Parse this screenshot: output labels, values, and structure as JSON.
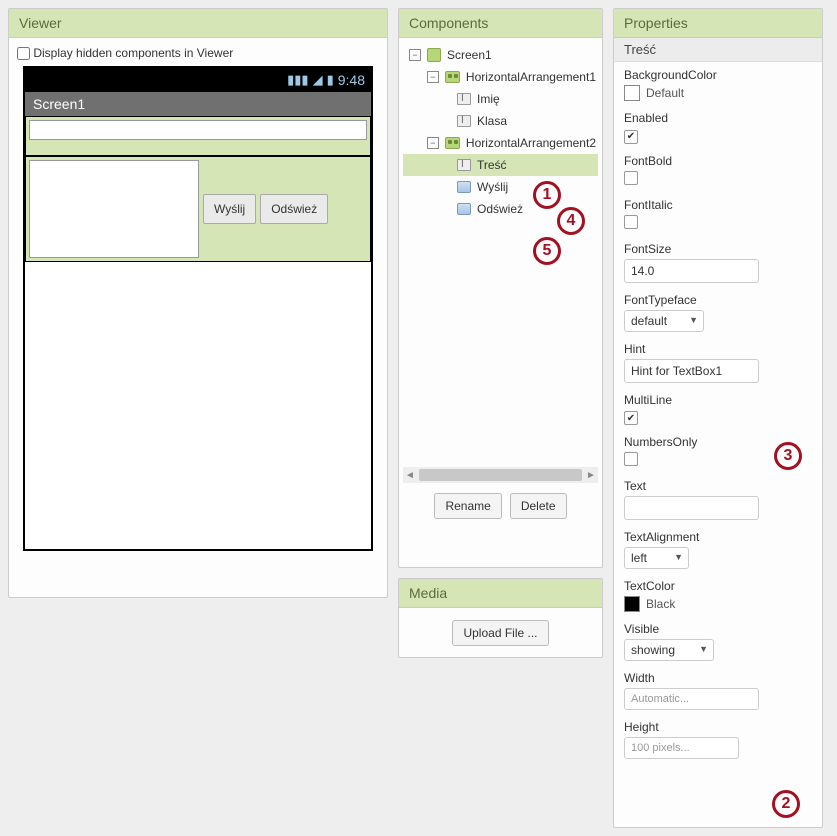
{
  "viewer": {
    "header": "Viewer",
    "hiddenLabel": "Display hidden components in Viewer",
    "hiddenChecked": false,
    "statusTime": "9:48",
    "screenTitle": "Screen1",
    "buttons": {
      "send": "Wyślij",
      "refresh": "Odśwież"
    }
  },
  "components": {
    "header": "Components",
    "tree": {
      "screen1": "Screen1",
      "harr1": "HorizontalArrangement1",
      "imie": "Imię",
      "klasa": "Klasa",
      "harr2": "HorizontalArrangement2",
      "tresc": "Treść",
      "wyslij": "Wyślij",
      "odswiez": "Odśwież"
    },
    "rename": "Rename",
    "delete": "Delete"
  },
  "media": {
    "header": "Media",
    "upload": "Upload File ..."
  },
  "properties": {
    "header": "Properties",
    "selected": "Treść",
    "BackgroundColor": {
      "label": "BackgroundColor",
      "value": "Default"
    },
    "Enabled": {
      "label": "Enabled",
      "checked": true
    },
    "FontBold": {
      "label": "FontBold",
      "checked": false
    },
    "FontItalic": {
      "label": "FontItalic",
      "checked": false
    },
    "FontSize": {
      "label": "FontSize",
      "value": "14.0"
    },
    "FontTypeface": {
      "label": "FontTypeface",
      "value": "default"
    },
    "Hint": {
      "label": "Hint",
      "value": "Hint for TextBox1"
    },
    "MultiLine": {
      "label": "MultiLine",
      "checked": true
    },
    "NumbersOnly": {
      "label": "NumbersOnly",
      "checked": false
    },
    "Text": {
      "label": "Text",
      "value": ""
    },
    "TextAlignment": {
      "label": "TextAlignment",
      "value": "left"
    },
    "TextColor": {
      "label": "TextColor",
      "value": "Black"
    },
    "Visible": {
      "label": "Visible",
      "value": "showing"
    },
    "Width": {
      "label": "Width",
      "value": "Automatic..."
    },
    "Height": {
      "label": "Height",
      "value": "100 pixels..."
    }
  },
  "annotations": {
    "a1": "1",
    "a2": "2",
    "a3": "3",
    "a4": "4",
    "a5": "5"
  }
}
